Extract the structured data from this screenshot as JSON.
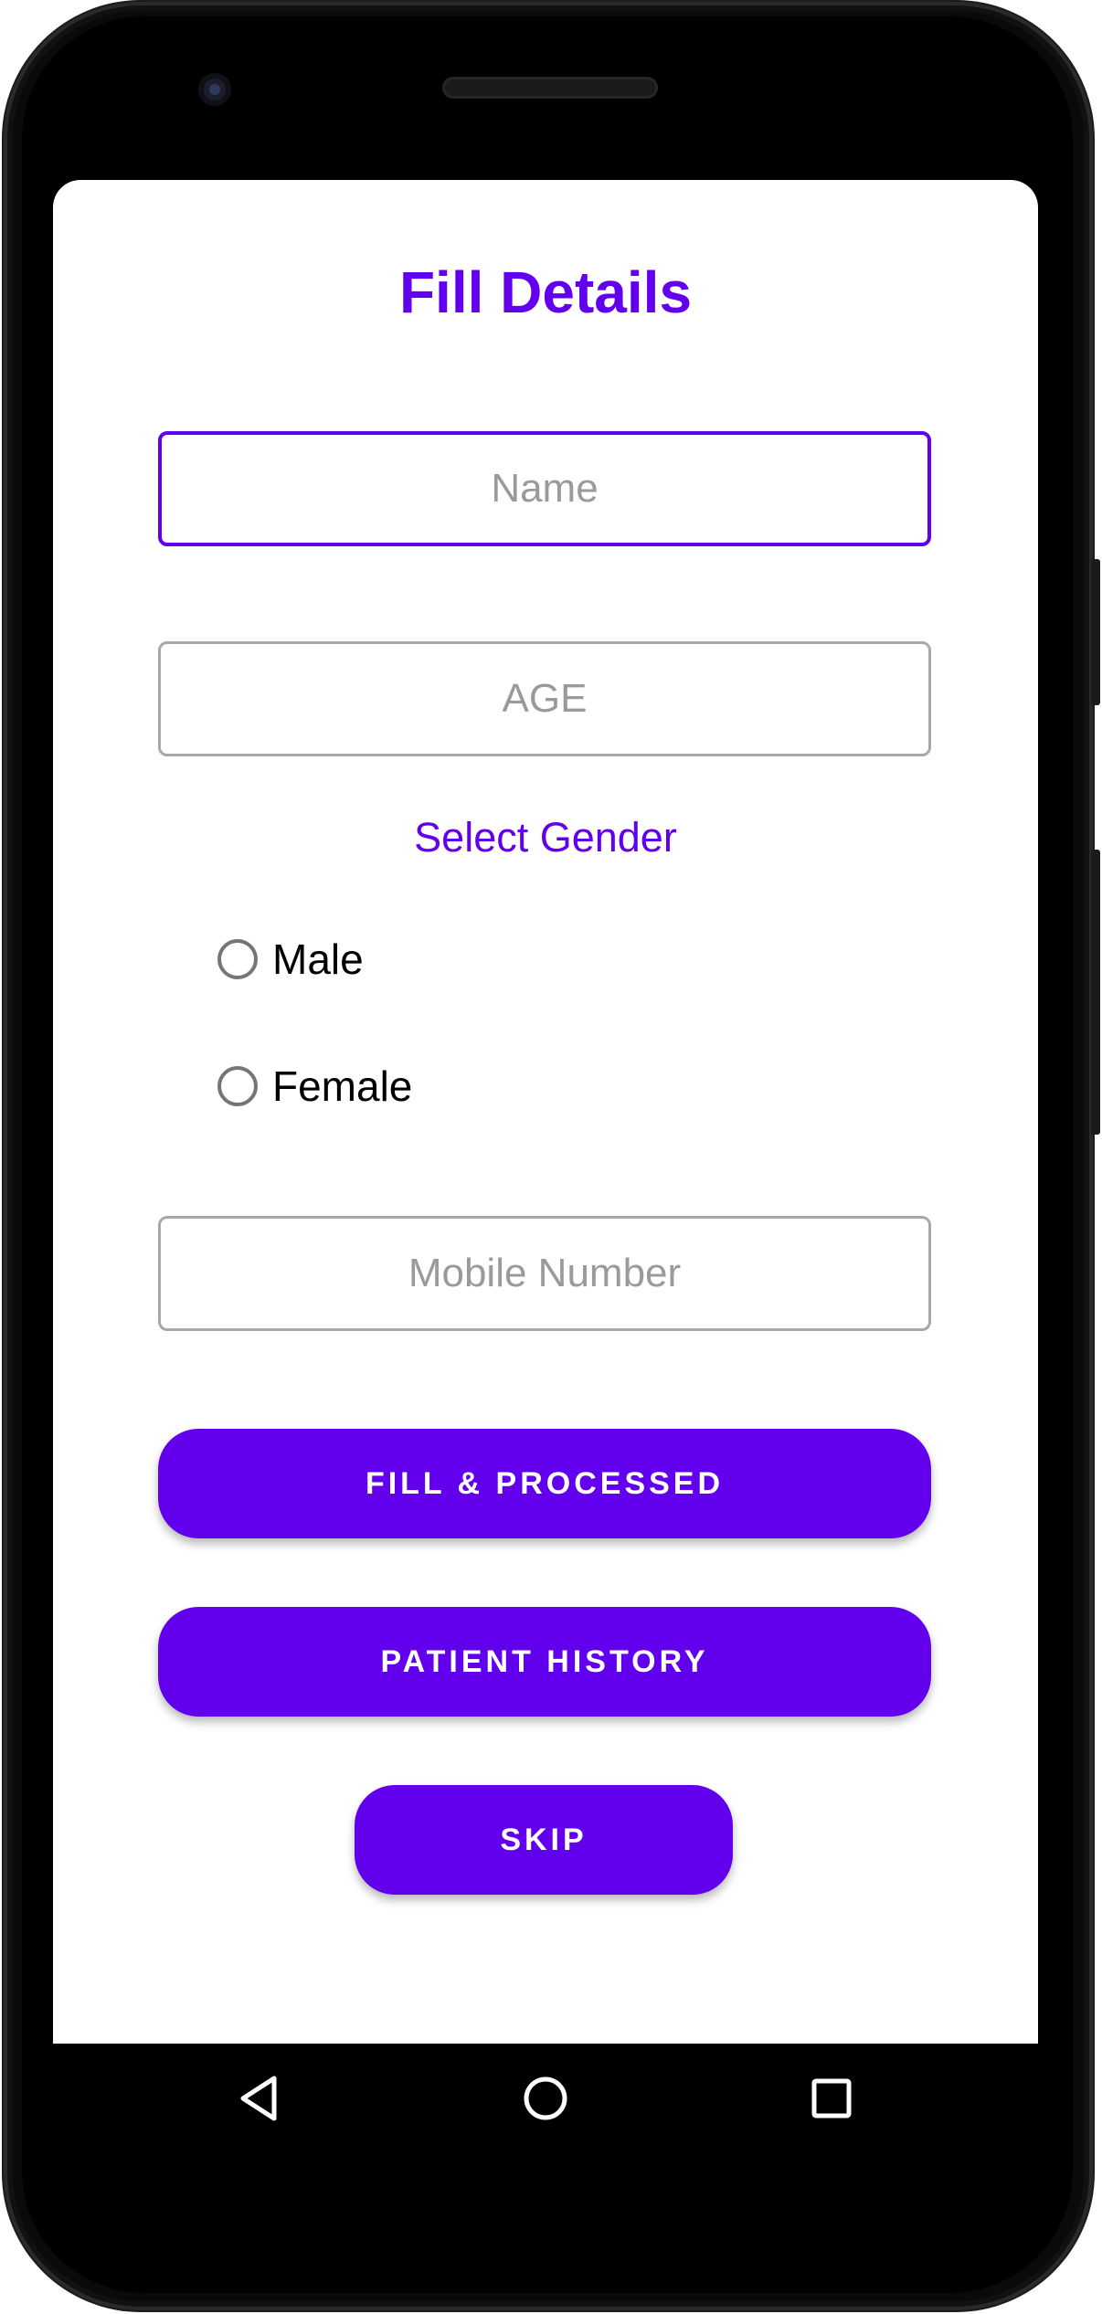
{
  "screen": {
    "title": "Fill Details",
    "name_field": {
      "placeholder": "Name",
      "value": ""
    },
    "age_field": {
      "placeholder": "AGE",
      "value": ""
    },
    "gender": {
      "label": "Select Gender",
      "options": [
        "Male",
        "Female"
      ]
    },
    "mobile_field": {
      "placeholder": "Mobile Number",
      "value": ""
    },
    "buttons": {
      "fill_processed": "FILL & PROCESSED",
      "patient_history": "PATIENT HISTORY",
      "skip": "SKIP"
    }
  },
  "navbar": {
    "icons": [
      "back-icon",
      "home-icon",
      "recents-icon"
    ]
  },
  "colors": {
    "accent": "#6200ee",
    "field_border": "#a8a8a8",
    "placeholder": "#9a9a9a",
    "radio": "#757575"
  }
}
